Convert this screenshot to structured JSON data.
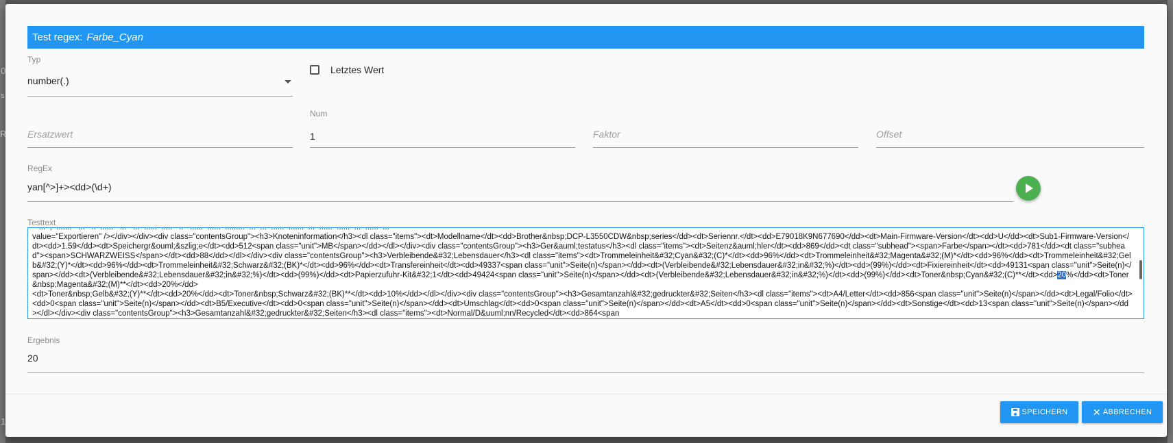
{
  "dialog": {
    "title_prefix": "Test regex:",
    "title_name": "Farbe_Cyan"
  },
  "typ": {
    "label": "Typ",
    "value": "number(.)"
  },
  "letztes_wert": {
    "label": "Letztes Wert",
    "checked": false
  },
  "ersatzwert": {
    "placeholder": "Ersatzwert"
  },
  "num": {
    "label": "Num",
    "value": "1"
  },
  "faktor": {
    "placeholder": "Faktor"
  },
  "offset": {
    "placeholder": "Offset"
  },
  "regex": {
    "label": "RegEx",
    "value": "yan[^>]+><dd>(\\d+)"
  },
  "testtext": {
    "label": "Testtext",
    "before": "   ...  ,  .......   ...   ..  ......   ...   ...  ......  .....   ..   ......  ......  .........  ...  ...  ......  .......  ...  ......  ......  ...  ......  ...\nvalue=\"Exportieren\" /></div></div><div class=\"contentsGroup\"><h3>Knoteninformation</h3><dl class=\"items\"><dt>Modellname</dt><dd>Brother&nbsp;DCP-L3550CDW&nbsp;series</dd><dt>Seriennr.</dt><dd>E79018K9N677690</dd><dt>Main-Firmware-Version</dt><dd>U</dd><dt>Sub1-Firmware-Version</dt><dd>1.59</dd><dt>Speichergr&ouml;&szlig;e</dt><dd>512<span class=\"unit\">MB</span></dd></dl></div><div class=\"contentsGroup\"><h3>Ger&auml;testatus</h3><dl class=\"items\"><dt>Seitenz&auml;hler</dt><dd>869</dd><dt class=\"subhead\"><span>Farbe</span></dt><dd>781</dd><dt class=\"subhead\"><span>SCHWARZWEISS</span></dt><dd>88</dd></dl></div><div class=\"contentsGroup\"><h3>Verbleibende&#32;Lebensdauer</h3><dl class=\"items\"><dt>Trommeleinheit&#32;Cyan&#32;(C)*</dt><dd>96%</dd><dt>Trommeleinheit&#32;Magenta&#32;(M)*</dt><dd>96%</dd><dt>Trommeleinheit&#32;Gelb&#32;(Y)*</dt><dd>96%</dd><dt>Trommeleinheit&#32;Schwarz&#32;(BK)*</dt><dd>96%</dd><dt>Transfereinheit</dt><dd>49337<span class=\"unit\">Seite(n)</span></dd><dt>(Verbleibende&#32;Lebensdauer&#32;in&#32;%)</dt><dd>(99%)</dd><dt>Fixiereinheit</dt><dd>49131<span class=\"unit\">Seite(n)</span></dd><dt>(Verbleibende&#32;Lebensdauer&#32;in&#32;%)</dt><dd>(99%)</dd><dt>Papierzufuhr-Kit&#32;1</dt><dd>49424<span class=\"unit\">Seite(n)</span></dd><dt>(Verbleibende&#32;Lebensdauer&#32;in&#32;%)</dt><dd>(99%)</dd><dt>Toner&nbsp;Cyan&#32;(C)**</dt><dd>",
    "highlight": "20",
    "after": "%</dd><dt>Toner&nbsp;Magenta&#32;(M)**</dt><dd>20%</dd>\n<dt>Toner&nbsp;Gelb&#32;(Y)**</dt><dd>20%</dd><dt>Toner&nbsp;Schwarz&#32;(BK)**</dt><dd>10%</dd></dl></div><div class=\"contentsGroup\"><h3>Gesamtanzahl&#32;gedruckter&#32;Seiten</h3><dl class=\"items\"><dt>A4/Letter</dt><dd>856<span class=\"unit\">Seite(n)</span></dd><dt>Legal/Folio</dt><dd>0<span class=\"unit\">Seite(n)</span></dd><dt>B5/Executive</dt><dd>0<span class=\"unit\">Seite(n)</span></dd><dt>Umschlag</dt><dd>0<span class=\"unit\">Seite(n)</span></dd><dt>A5</dt><dd>0<span class=\"unit\">Seite(n)</span></dd><dt>Sonstige</dt><dd>13<span class=\"unit\">Seite(n)</span></dd></dl></div><div class=\"contentsGroup\"><h3>Gesamtanzahl&#32;gedruckter&#32;Seiten</h3><dl class=\"items\"><dt>Normal/D&uuml;nn/Recycled</dt><dd>864<span"
  },
  "ergebnis": {
    "label": "Ergebnis",
    "value": "20"
  },
  "buttons": {
    "save": "SPEICHERN",
    "cancel": "ABBRECHEN"
  },
  "background": {
    "left_fragment_1": "0",
    "left_fragment_2": "s",
    "left_fragment_3": "Re",
    "left_fragment_4": "1"
  },
  "colors": {
    "accent": "#2196f3",
    "run_button": "#4caf50"
  }
}
